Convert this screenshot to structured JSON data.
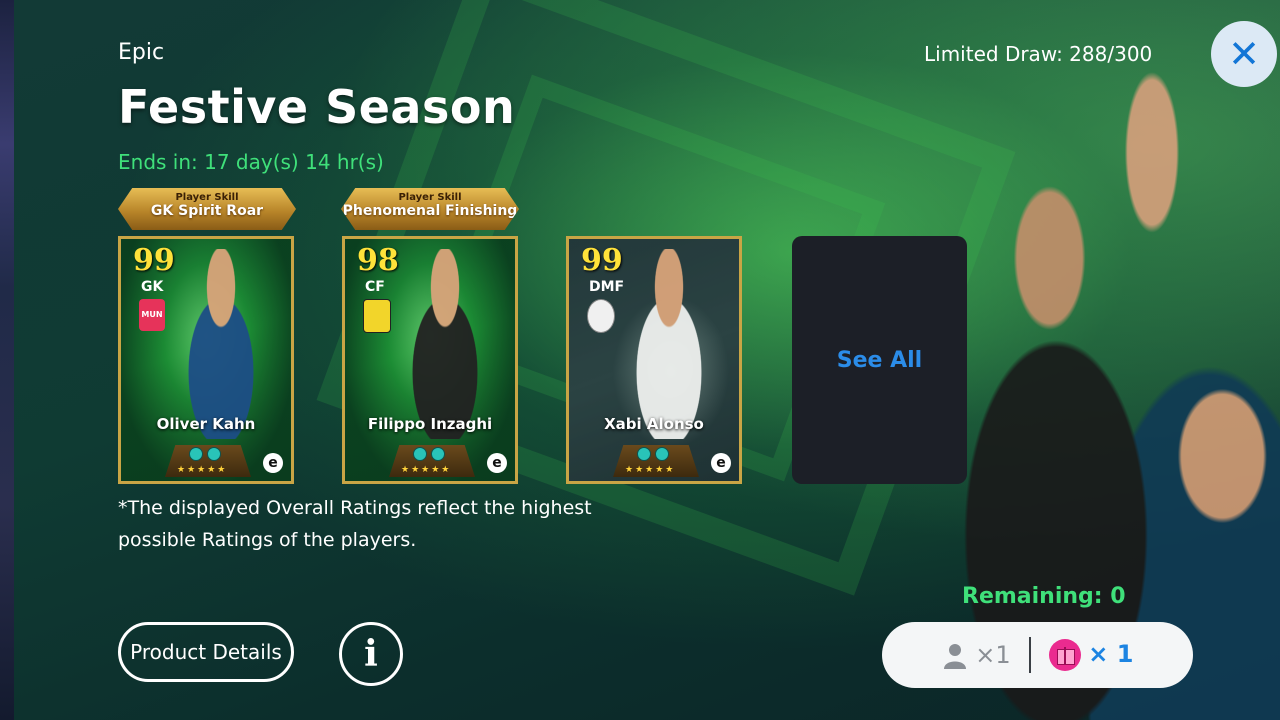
{
  "banner": {
    "rarity": "Epic",
    "title": "Festive Season",
    "ends_in": "Ends in: 17 day(s) 14 hr(s)",
    "limited_draw": "Limited Draw: 288/300"
  },
  "close": {
    "icon": "close-icon",
    "glyph": "✕"
  },
  "skills": [
    {
      "small": "Player Skill",
      "name": "GK Spirit Roar"
    },
    {
      "small": "Player Skill",
      "name": "Phenomenal Finishing"
    }
  ],
  "cards": [
    {
      "rating": "99",
      "position": "GK",
      "name": "Oliver Kahn",
      "crest": "MUN",
      "kit": "#1d4e86"
    },
    {
      "rating": "98",
      "position": "CF",
      "name": "Filippo Inzaghi",
      "crest": "",
      "kit": "#222222"
    },
    {
      "rating": "99",
      "position": "DMF",
      "name": "Xabi Alonso",
      "crest": "",
      "kit": "#eef0ee"
    }
  ],
  "card_common": {
    "stars": "★★★★★",
    "brand": "e"
  },
  "see_all": "See All",
  "note": "*The displayed Overall Ratings reflect the highest possible Ratings of the players.",
  "buttons": {
    "product_details": "Product Details",
    "info": "i"
  },
  "remaining": "Remaining: 0",
  "draw": {
    "player_count": "×1",
    "gift_count": "× 1"
  },
  "colors": {
    "accent_green": "#3fe07a",
    "accent_blue": "#1c84e2",
    "gold": "#c9a545"
  }
}
